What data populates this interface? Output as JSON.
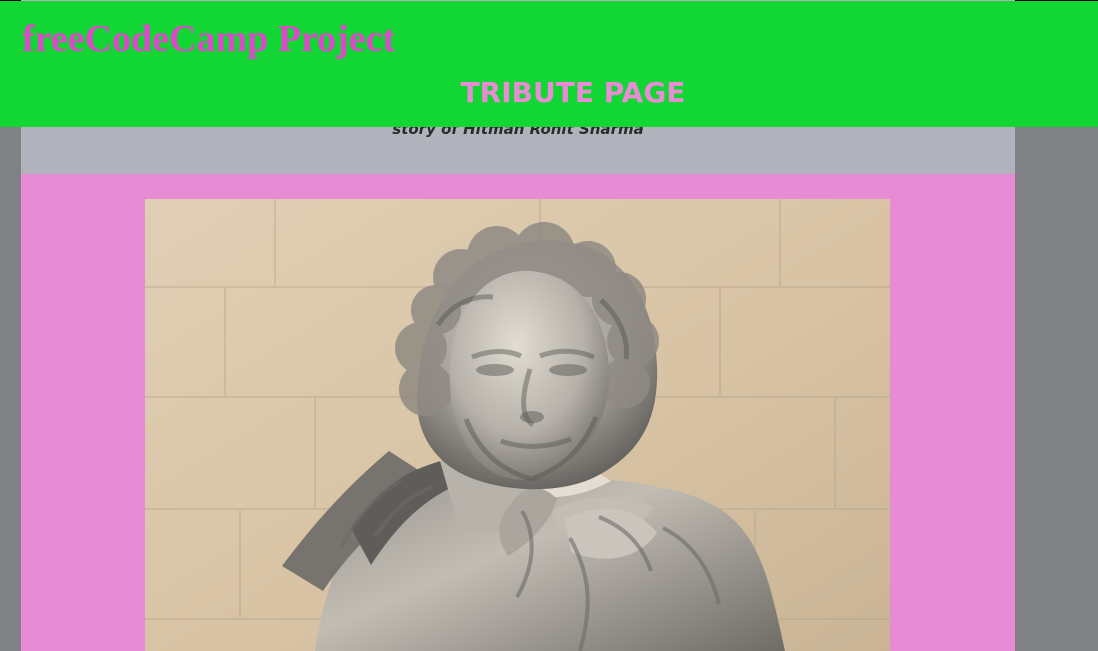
{
  "header": {
    "brand": "freeCodeCamp Project",
    "title": "TRIBUTE PAGE"
  },
  "main": {
    "subtitle": "story of Hitman Rohit Sharma"
  },
  "colors": {
    "page_background": "#808184",
    "header_background": "#12d634",
    "brand_text": "#db4ac9",
    "title_text": "#e98bd5",
    "content_background": "#b0b3bb",
    "image_panel_background": "#e78bd5"
  }
}
